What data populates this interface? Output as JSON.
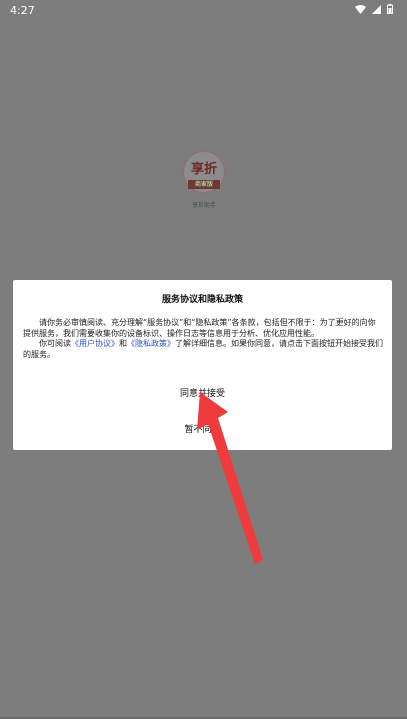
{
  "status_bar": {
    "time": "4:27",
    "icons": [
      "wifi-icon",
      "signal-icon",
      "battery-icon"
    ]
  },
  "splash": {
    "logo_text": "享折",
    "logo_ribbon": "商家版",
    "caption": "享折助手"
  },
  "dialog": {
    "title": "服务协议和隐私政策",
    "paragraph1": "请你务必审慎阅读、充分理解“服务协议”和“隐私政策”各条款，包括但不限于：为了更好的向你提供服务，我们需要收集你的设备标识、操作日志等信息用于分析、优化应用性能。",
    "p2_prefix": "你可阅读",
    "user_agreement_link": "《用户协议》",
    "p2_and": "和",
    "privacy_policy_link": "《隐私政策》",
    "p2_suffix": "了解详细信息。如果你同意，请点击下面按钮开始接受我们的服务。",
    "agree_button": "同意并接受",
    "reject_button": "暂不同意"
  },
  "colors": {
    "overlay": "#7d7d7d",
    "link": "#2b52c9",
    "arrow": "#ef3b3b"
  }
}
